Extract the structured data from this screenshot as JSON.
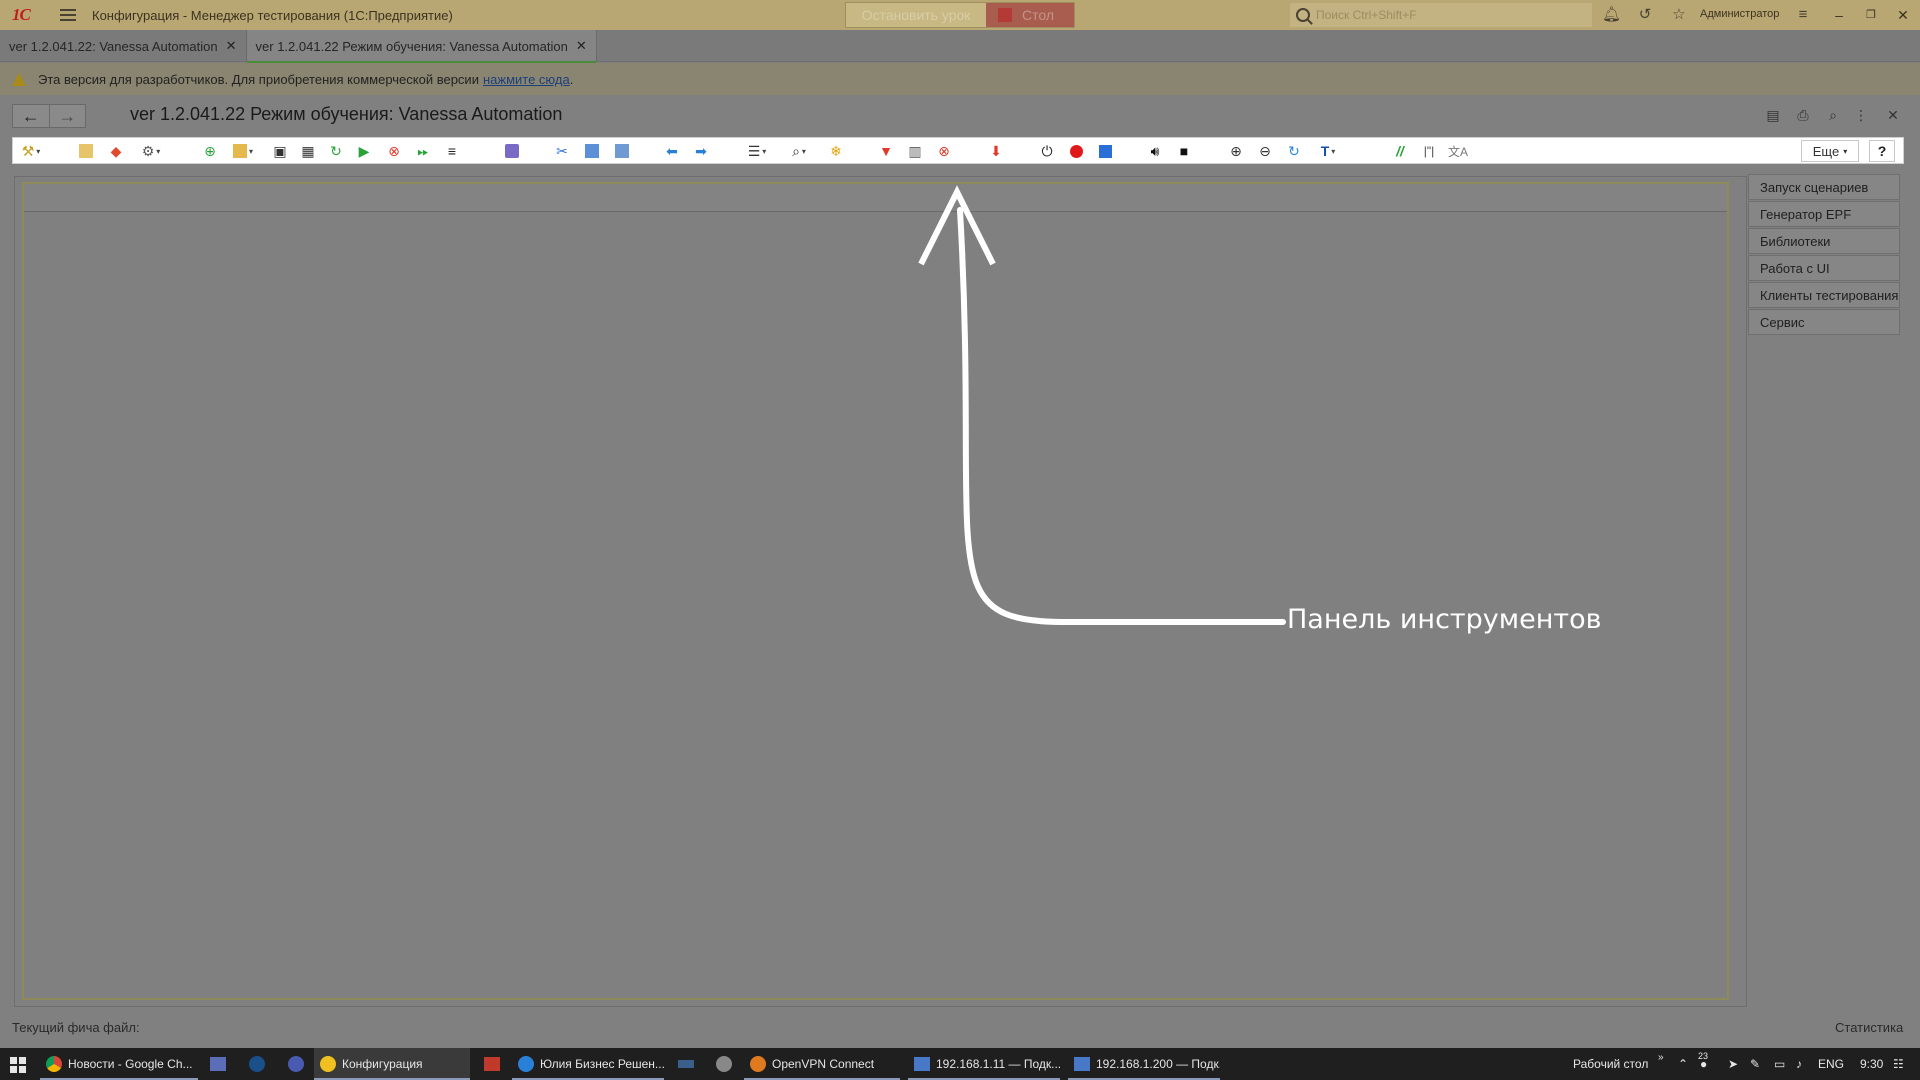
{
  "titlebar": {
    "logo": "1С",
    "title": "Конфигурация  - Менеджер тестирования (1С:Предприятие)",
    "stop_lesson": "Остановить урок",
    "desk": "Стол",
    "search_placeholder": "Поиск Ctrl+Shift+F",
    "user": "Администратор"
  },
  "tabs": [
    {
      "label": "ver 1.2.041.22: Vanessa Automation",
      "active": false
    },
    {
      "label": "ver 1.2.041.22 Режим обучения: Vanessa Automation",
      "active": true
    }
  ],
  "banner": {
    "text": "Эта версия для разработчиков. Для приобретения коммерческой версии",
    "link": "нажмите сюда",
    "tail": "."
  },
  "form": {
    "title": "ver 1.2.041.22 Режим обучения: Vanessa Automation"
  },
  "toolbar": {
    "more_label": "Еще",
    "help_label": "?"
  },
  "side_panel": {
    "items": [
      "Запуск сценариев",
      "Генератор EPF",
      "Библиотеки",
      "Работа с UI",
      "Клиенты тестирования",
      "Сервис"
    ]
  },
  "annotation": {
    "text": "Панель инструментов"
  },
  "status": {
    "left": "Текущий фича файл:",
    "right": "Статистика"
  },
  "taskbar": {
    "items": [
      "Новости - Google Ch...",
      "Конфигурация",
      "Юлия Бизнес Решен...",
      "OpenVPN Connect",
      "192.168.1.11 — Подк...",
      "192.168.1.200 — Подк..."
    ],
    "desktop": "Рабочий стол",
    "lang": "ENG",
    "time": "9:30",
    "badge": "23"
  },
  "colors": {
    "titlebar": "#b9a773",
    "overlay": "#808080",
    "accent_tab": "#4a8a3c",
    "link": "#1d3f7a"
  }
}
